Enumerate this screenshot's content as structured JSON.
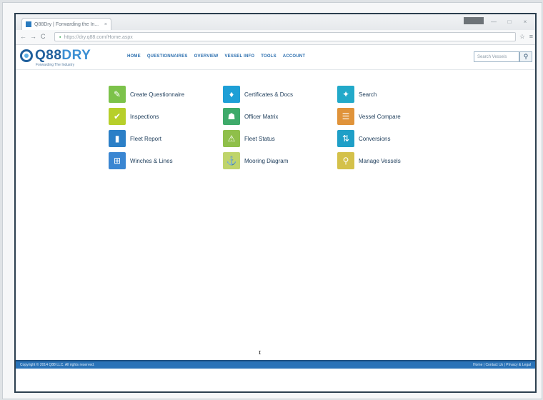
{
  "browser": {
    "tab_title": "Q88Dry | Forwarding the In...",
    "tab_close": "×",
    "url": "https://dry.q88.com/Home.aspx",
    "back": "←",
    "forward": "→",
    "reload": "C",
    "star": "☆",
    "menu": "≡",
    "win_min": "—",
    "win_max": "□",
    "win_close": "×"
  },
  "site": {
    "logo_text_a": "Q88",
    "logo_text_b": "DRY",
    "logo_tagline": "Forwarding The Industry",
    "nav": [
      "HOME",
      "QUESTIONNAIRES",
      "OVERVIEW",
      "VESSEL INFO",
      "TOOLS",
      "ACCOUNT"
    ],
    "search_placeholder": "Search Vessels",
    "search_icon": "magnifier"
  },
  "tiles": [
    {
      "label": "Create Questionnaire",
      "icon": "pencil-icon",
      "glyph": "✎",
      "color": "#7cc24a"
    },
    {
      "label": "Certificates & Docs",
      "icon": "certificate-icon",
      "glyph": "♦",
      "color": "#1e9fd6"
    },
    {
      "label": "Search",
      "icon": "search-icon",
      "glyph": "✦",
      "color": "#22a9c9"
    },
    {
      "label": "Inspections",
      "icon": "check-icon",
      "glyph": "✔",
      "color": "#b7cf2a"
    },
    {
      "label": "Officer Matrix",
      "icon": "officer-cap-icon",
      "glyph": "☗",
      "color": "#3eaa6a"
    },
    {
      "label": "Vessel Compare",
      "icon": "compare-icon",
      "glyph": "☰",
      "color": "#e0933a"
    },
    {
      "label": "Fleet Report",
      "icon": "bar-chart-icon",
      "glyph": "▮",
      "color": "#2b7fc7"
    },
    {
      "label": "Fleet Status",
      "icon": "warning-icon",
      "glyph": "⚠",
      "color": "#8fbf4a"
    },
    {
      "label": "Conversions",
      "icon": "conversions-icon",
      "glyph": "⇅",
      "color": "#1f9fc7"
    },
    {
      "label": "Winches & Lines",
      "icon": "winch-icon",
      "glyph": "⊞",
      "color": "#3a86d2"
    },
    {
      "label": "Mooring Diagram",
      "icon": "mooring-icon",
      "glyph": "⚓",
      "color": "#bfd46a"
    },
    {
      "label": "Manage Vessels",
      "icon": "magnify-vessel-icon",
      "glyph": "⚲",
      "color": "#d4c14a"
    }
  ],
  "footer": {
    "left": "Copyright © 2014 Q88 LLC. All rights reserved.",
    "right": "Home | Contact Us | Privacy & Legal"
  }
}
